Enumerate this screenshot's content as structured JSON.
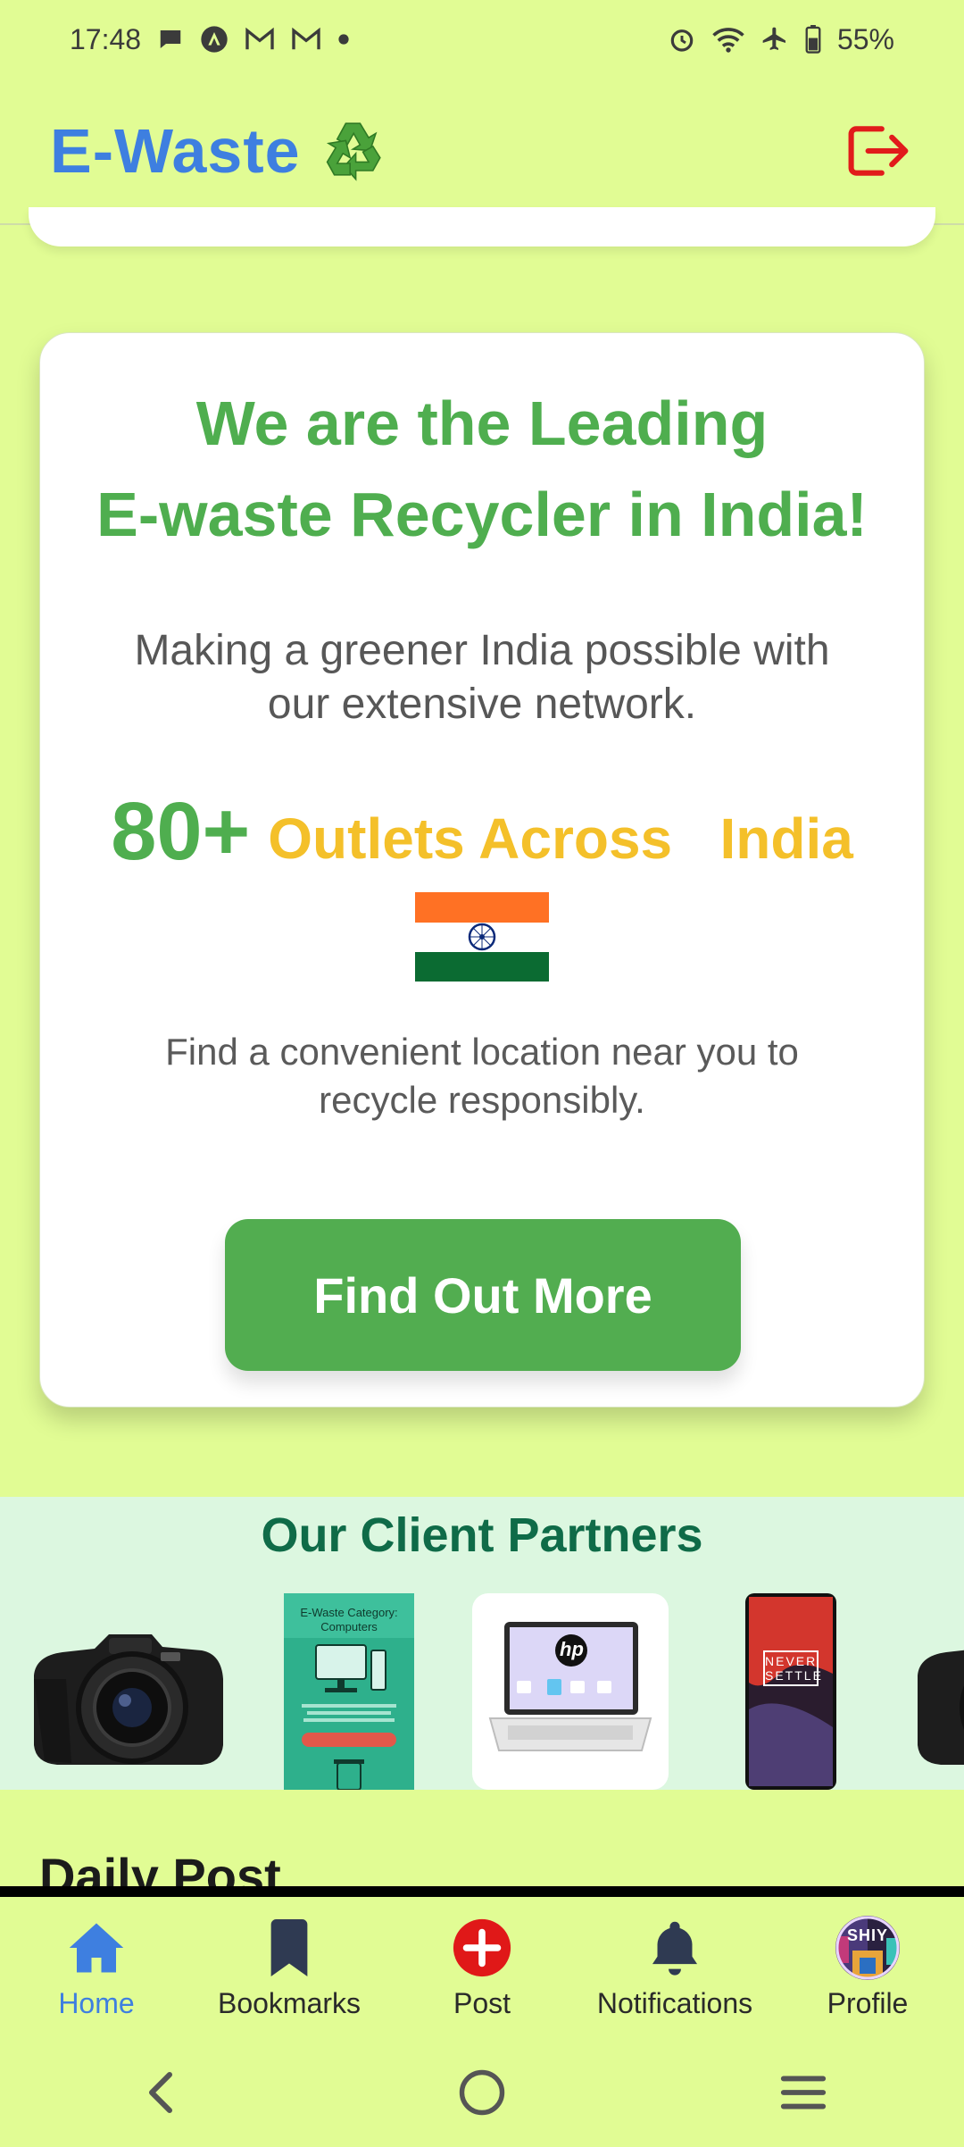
{
  "status_bar": {
    "time": "17:48",
    "battery": "55%"
  },
  "header": {
    "title": "E-Waste",
    "logo_icon": "recycle-icon",
    "logout_icon": "logout-icon"
  },
  "hero": {
    "title_line1": "We are the Leading",
    "title_line2": "E-waste Recycler in India!",
    "subtitle": "Making a greener India possible with our extensive network.",
    "stat_number": "80+",
    "stat_text": "Outlets Across   India",
    "description": "Find a convenient location near you to recycle responsibly.",
    "cta_label": "Find Out More"
  },
  "partners": {
    "title": "Our Client Partners",
    "brochure_title": "E-Waste Category: Computers",
    "phone_text_1": "NEVER",
    "phone_text_2": "SETTLE",
    "laptop_logo": "hp"
  },
  "daily_post": {
    "title": "Daily Post"
  },
  "bottom_nav": {
    "items": [
      {
        "label": "Home",
        "icon": "home-icon",
        "active": true
      },
      {
        "label": "Bookmarks",
        "icon": "bookmark-icon",
        "active": false
      },
      {
        "label": "Post",
        "icon": "plus-circle-icon",
        "active": false
      },
      {
        "label": "Notifications",
        "icon": "bell-icon",
        "active": false
      },
      {
        "label": "Profile",
        "icon": "avatar-icon",
        "active": false
      }
    ],
    "avatar_text": "SHIY"
  },
  "colors": {
    "background": "#e1fc94",
    "brand_blue": "#3e7fe0",
    "green": "#4fae4f",
    "yellow": "#f4c02a",
    "logout_red": "#e11b1b"
  }
}
